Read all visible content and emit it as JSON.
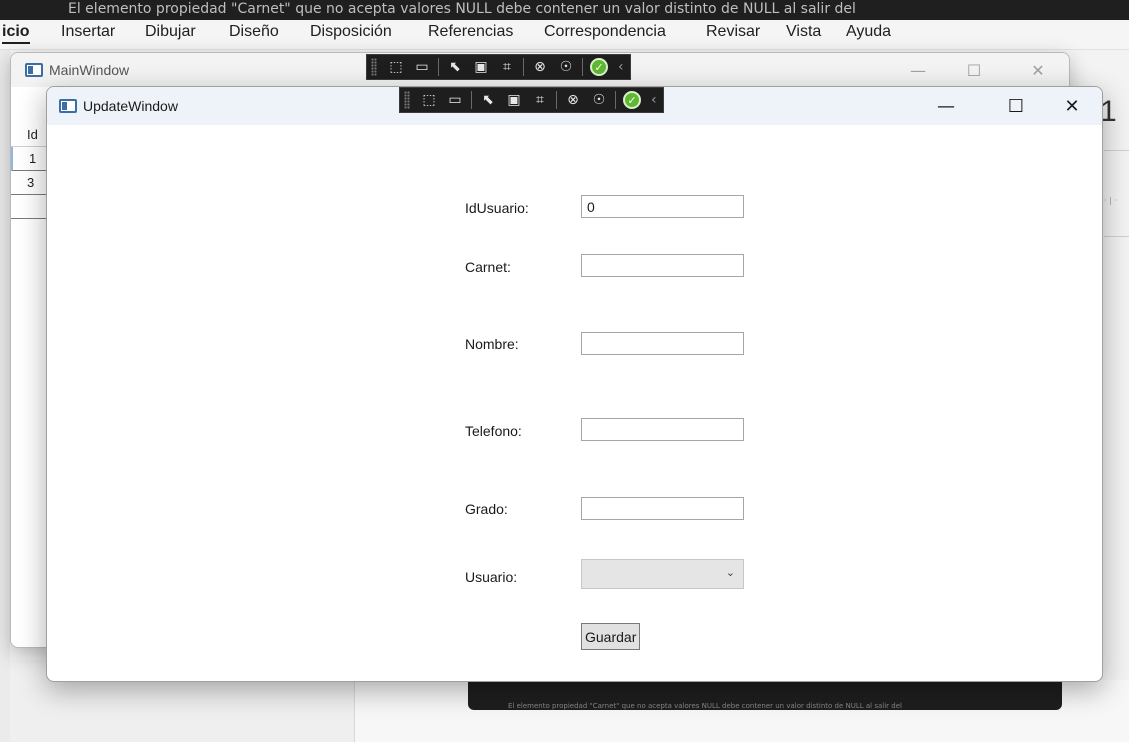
{
  "background": {
    "notification_text": "El elemento propiedad \"Carnet\" que no acepta valores NULL debe contener un valor distinto de NULL al salir del",
    "menu": [
      "icio",
      "Insertar",
      "Dibujar",
      "Diseño",
      "Disposición",
      "Referencias",
      "Correspondencia",
      "Revisar",
      "Vista",
      "Ayuda"
    ],
    "banner_text": "El elemento propiedad \"Carnet\" que no acepta valores NULL debe contener un valor distinto de NULL al salir del",
    "right_stub": "1"
  },
  "main_window": {
    "title": "MainWindow",
    "grid": {
      "header": "Id",
      "rows": [
        "1",
        "3",
        ""
      ]
    }
  },
  "update_window": {
    "title": "UpdateWindow",
    "fields": [
      {
        "label": "IdUsuario:",
        "value": "0"
      },
      {
        "label": "Carnet:",
        "value": ""
      },
      {
        "label": "Nombre:",
        "value": ""
      },
      {
        "label": "Telefono:",
        "value": ""
      },
      {
        "label": "Grado:",
        "value": ""
      }
    ],
    "usuario": {
      "label": "Usuario:",
      "selected": ""
    },
    "save_label": "Guardar"
  },
  "caption": {
    "minimize": "—",
    "maximize": "☐",
    "close": "✕"
  },
  "icons": [
    "select-element-icon",
    "preview-icon",
    "pointer-icon",
    "layout-adorner-icon",
    "track-focus-icon",
    "binding-failures-icon",
    "accessibility-icon",
    "hot-reload-ok-icon",
    "collapse-chevron-icon"
  ]
}
